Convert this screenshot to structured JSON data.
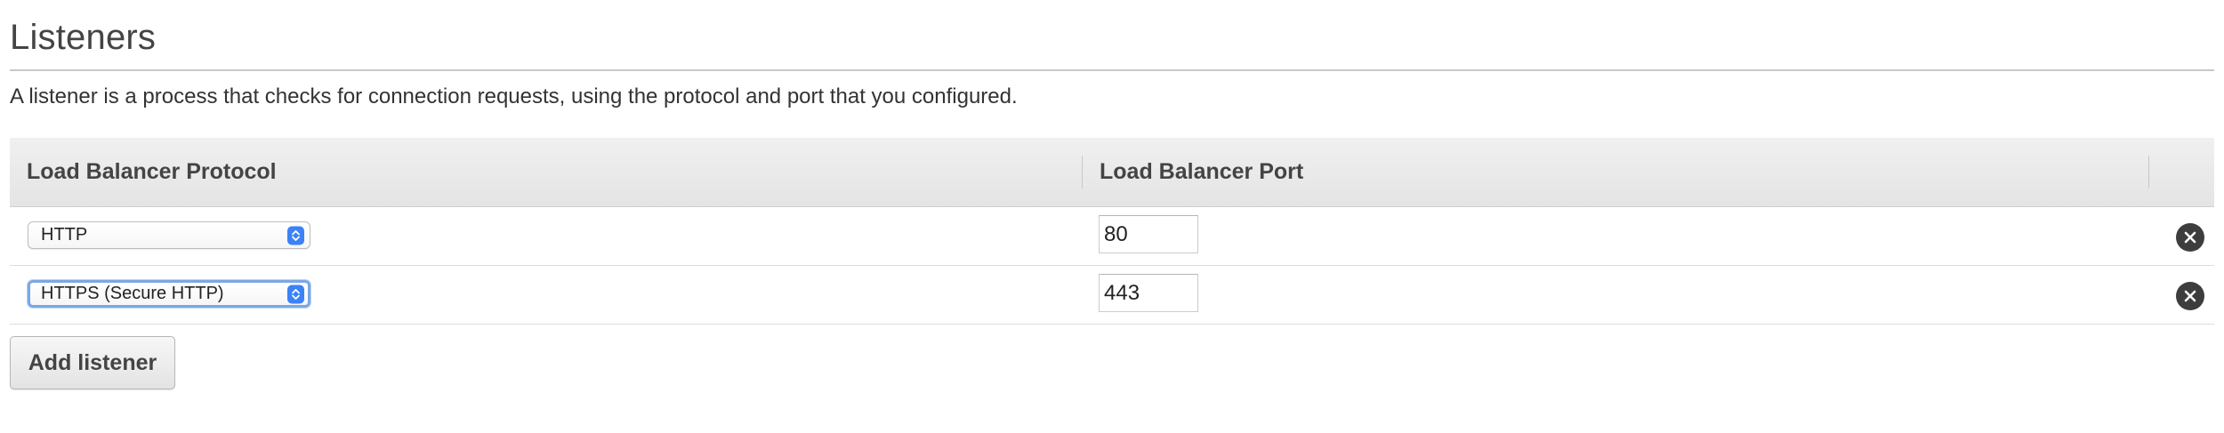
{
  "section": {
    "title": "Listeners",
    "description": "A listener is a process that checks for connection requests, using the protocol and port that you configured."
  },
  "table": {
    "columns": [
      "Load Balancer Protocol",
      "Load Balancer Port"
    ],
    "rows": [
      {
        "protocol": "HTTP",
        "port": "80",
        "focused": false
      },
      {
        "protocol": "HTTPS (Secure HTTP)",
        "port": "443",
        "focused": true
      }
    ]
  },
  "actions": {
    "add_listener_label": "Add listener"
  },
  "icons": {
    "select": "select-arrows-icon",
    "remove": "remove-circle-icon"
  },
  "colors": {
    "select_accent": "#3b82f6",
    "focus_ring": "#7aa7e6",
    "remove_icon": "#3d3d3d",
    "header_bg": "#e9e9e9"
  }
}
